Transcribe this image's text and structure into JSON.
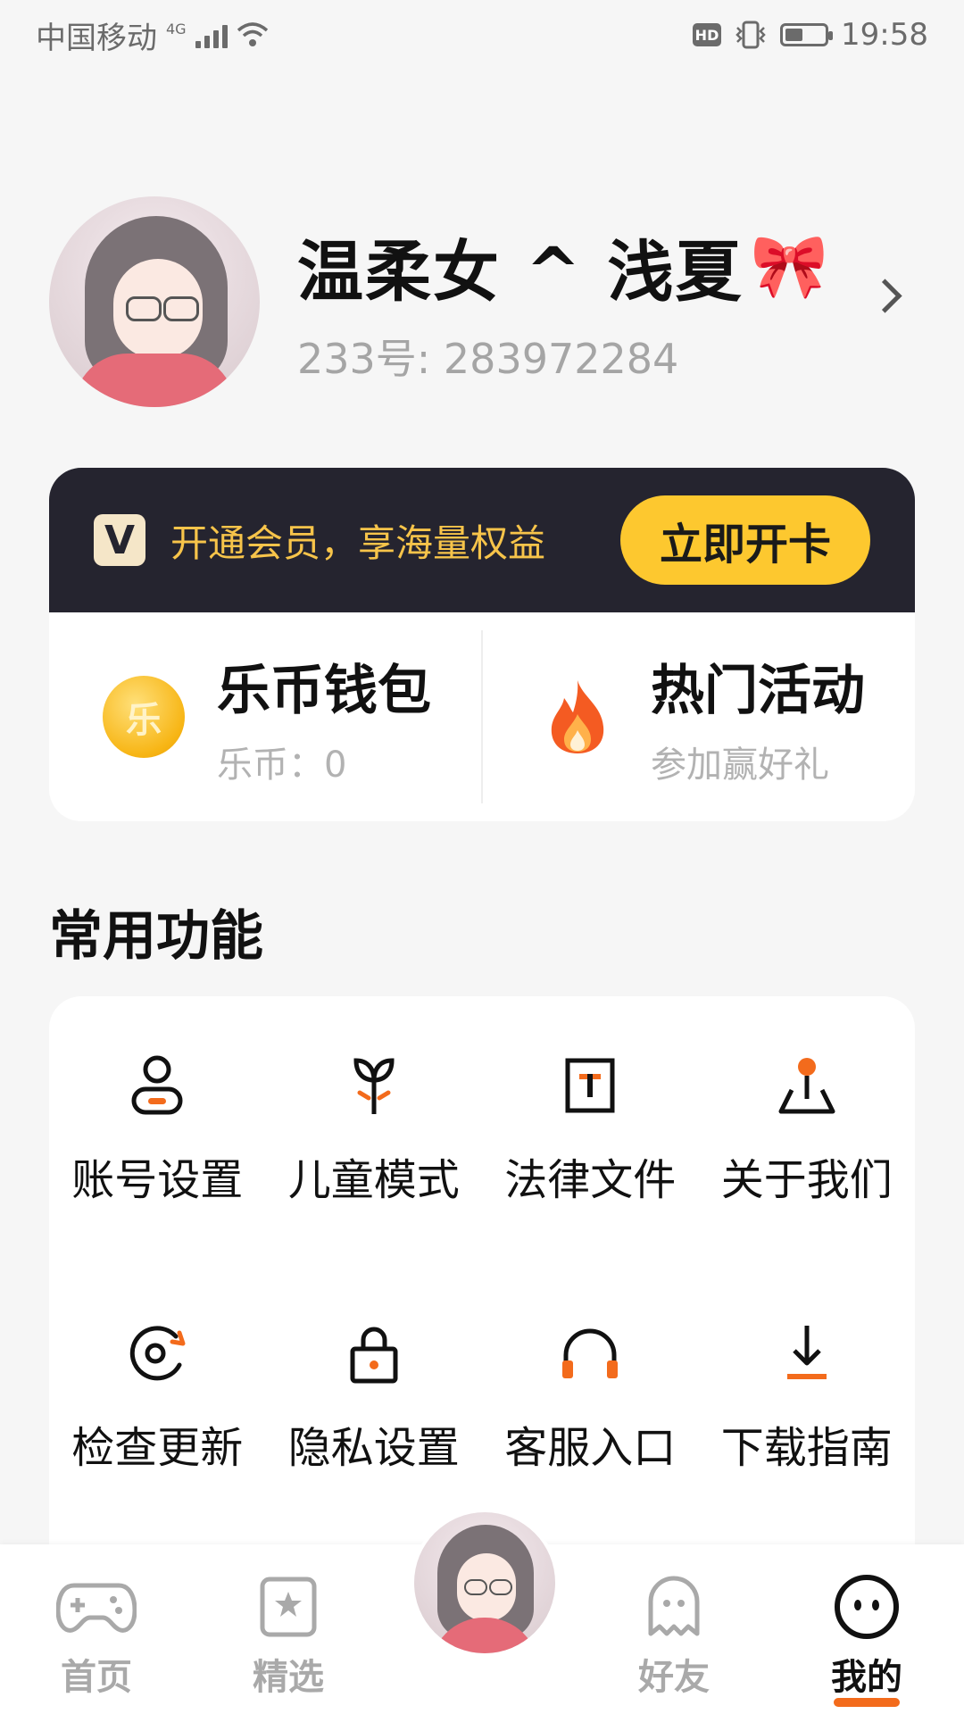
{
  "status_bar": {
    "carrier": "中国移动",
    "network": "4G",
    "time": "19:58",
    "hd_label": "HD",
    "battery_level": 0.45
  },
  "profile": {
    "nickname": "温柔女 ^ 浅夏",
    "bow_icon": "🎀",
    "uid": "233号: 283972284"
  },
  "vip": {
    "text": "开通会员，享海量权益",
    "button": "立即开卡",
    "icon_letter": "V",
    "accent": "#f7c44a",
    "bg": "#25242f"
  },
  "wallet": {
    "title": "乐币钱包",
    "sub": "乐币：0",
    "coin_char": "乐"
  },
  "activity": {
    "title": "热门活动",
    "sub": "参加赢好礼"
  },
  "section": {
    "title": "常用功能"
  },
  "functions": [
    {
      "label": "账号设置",
      "icon": "account-icon"
    },
    {
      "label": "儿童模式",
      "icon": "sprout-icon"
    },
    {
      "label": "法律文件",
      "icon": "document-icon"
    },
    {
      "label": "关于我们",
      "icon": "location-pin-icon"
    },
    {
      "label": "检查更新",
      "icon": "refresh-icon"
    },
    {
      "label": "隐私设置",
      "icon": "lock-icon"
    },
    {
      "label": "客服入口",
      "icon": "headphones-icon"
    },
    {
      "label": "下载指南",
      "icon": "download-icon"
    }
  ],
  "bottom_nav": [
    {
      "label": "首页",
      "icon": "gamepad-icon"
    },
    {
      "label": "精选",
      "icon": "star-card-icon"
    },
    {
      "label": "好友",
      "icon": "ghost-icon"
    },
    {
      "label": "我的",
      "icon": "face-icon",
      "active": true
    }
  ],
  "colors": {
    "accent_orange": "#f36b1c",
    "button_yellow": "#fdc82f"
  }
}
